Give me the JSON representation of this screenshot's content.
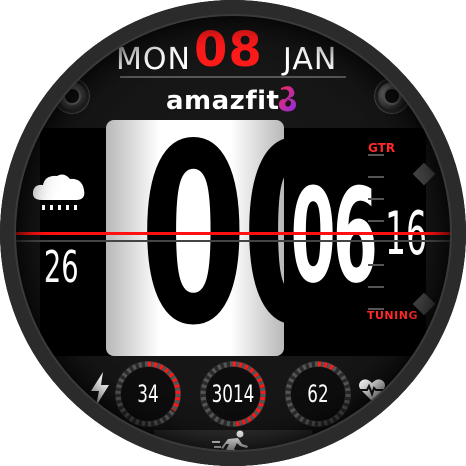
{
  "date": {
    "weekday": "MON",
    "day": "08",
    "month": "JAN"
  },
  "brand": {
    "name": "amazfit",
    "logo_icon": "amazfit-logo-icon",
    "logo_color_start": "#ff2a55",
    "logo_color_end": "#8a2be2"
  },
  "time": {
    "hours": "00",
    "minutes": "06",
    "seconds": "16"
  },
  "labels": {
    "top": "GTR",
    "bottom": "TUNING"
  },
  "weather": {
    "icon": "rain-cloud-icon",
    "temperature": "26"
  },
  "stats": [
    {
      "name": "battery",
      "icon": "lightning-bolt-icon",
      "value": "34",
      "progress": 0.34
    },
    {
      "name": "steps",
      "icon": "",
      "value": "3014",
      "progress": 0.5
    },
    {
      "name": "heart-rate",
      "icon": "heart-pulse-icon",
      "value": "62",
      "progress": 0.1
    }
  ],
  "bottom": {
    "icon": "running-person-icon"
  },
  "colors": {
    "accent": "#ff1010",
    "text": "#ffffff",
    "background": "#151515"
  }
}
